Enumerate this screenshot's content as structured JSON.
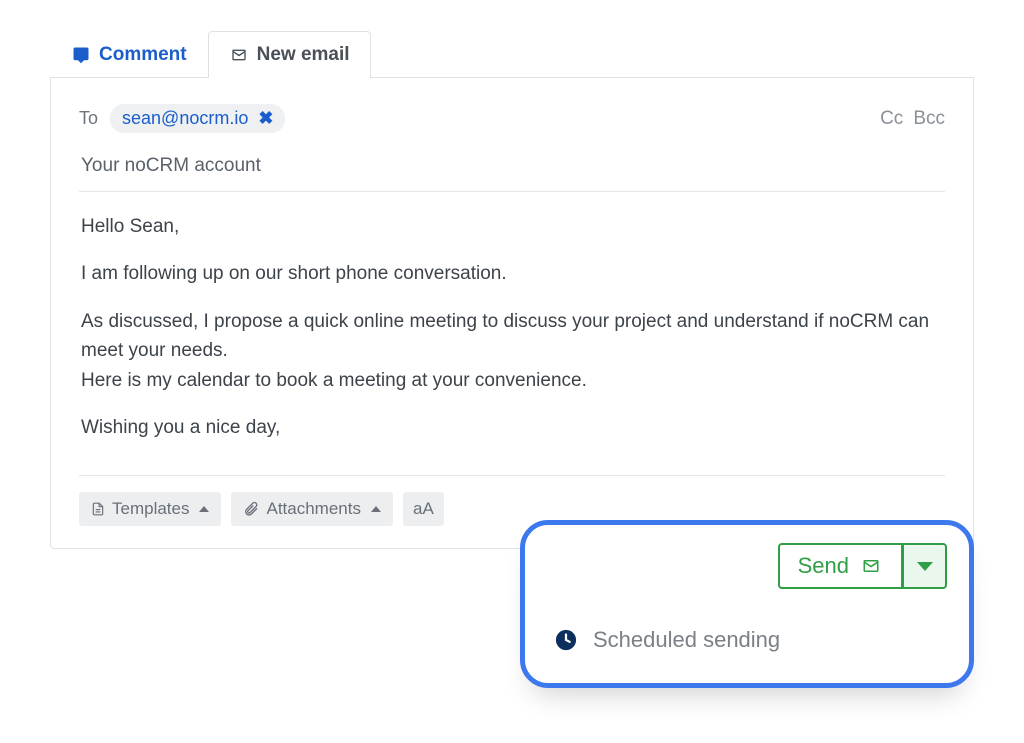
{
  "tabs": {
    "comment": "Comment",
    "new_email": "New email"
  },
  "compose": {
    "to_label": "To",
    "recipient": "sean@nocrm.io",
    "cc_label": "Cc",
    "bcc_label": "Bcc",
    "subject": "Your noCRM account",
    "body": {
      "p1": "Hello Sean,",
      "p2": "I am following up on our short phone conversation.",
      "p3": "As discussed, I propose a quick online meeting to discuss your project and understand if noCRM can meet your needs.",
      "p4": "Here is my calendar to book a meeting at your convenience.",
      "p5": "Wishing you a nice day,"
    }
  },
  "toolbar": {
    "templates": "Templates",
    "attachments": "Attachments",
    "formatting": "aA"
  },
  "send": {
    "button_label": "Send",
    "dropdown_item": "Scheduled sending"
  },
  "colors": {
    "primary_blue": "#1b5ecb",
    "highlight_border": "#3d78ef",
    "send_green": "#2f9e44"
  }
}
